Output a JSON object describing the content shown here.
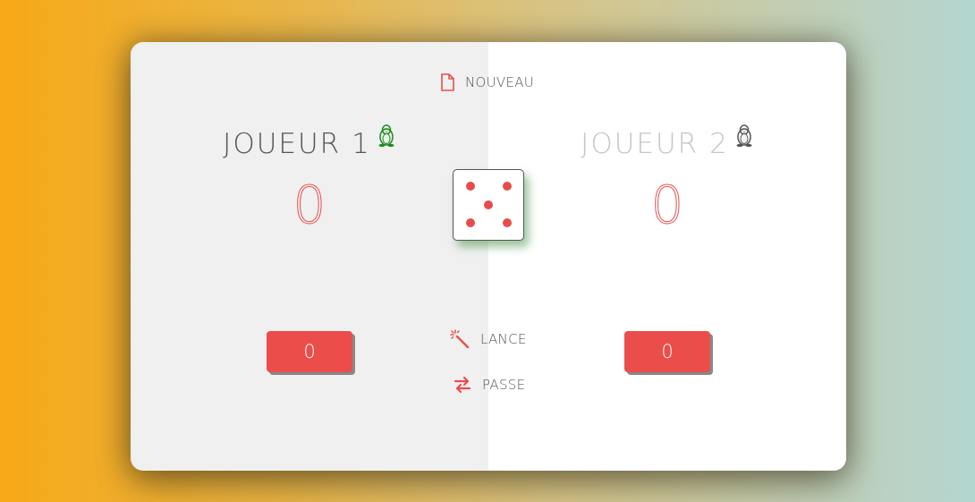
{
  "colors": {
    "accent": "#eb4d4b",
    "active_player_tux": "#1e8a1e",
    "inactive_player_tux": "#555555"
  },
  "controls": {
    "new_label": "NOUVEAU",
    "roll_label": "LANCE",
    "hold_label": "PASSE"
  },
  "players": [
    {
      "name": "JOUEUR 1",
      "score": "0",
      "current": "0",
      "active": true,
      "icon": "tux-icon"
    },
    {
      "name": "JOUEUR 2",
      "score": "0",
      "current": "0",
      "active": false,
      "icon": "tux-icon"
    }
  ],
  "dice": {
    "value": 5
  }
}
